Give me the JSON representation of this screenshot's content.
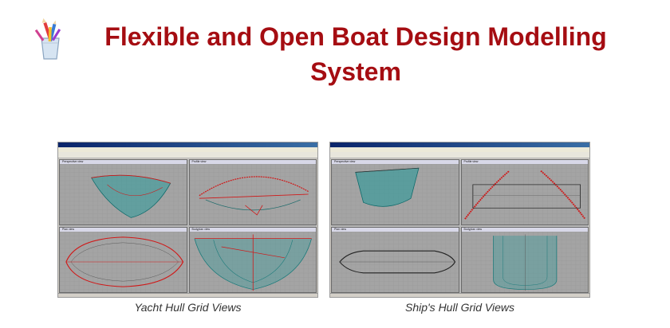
{
  "header": {
    "title_line1": "Flexible and Open Boat Design Modelling",
    "title_line2": "System",
    "title_color": "#a50d12",
    "logo_icon": "pencil-cup-icon"
  },
  "screenshots": [
    {
      "caption": "Yacht Hull Grid Views",
      "panes": [
        "Perspective view",
        "Profile view",
        "Plan view",
        "Bodyplan view"
      ]
    },
    {
      "caption": "Ship's Hull Grid Views",
      "panes": [
        "Perspective view",
        "Profile view",
        "Plan view",
        "Bodyplan view"
      ]
    }
  ],
  "colors": {
    "grid_bg": "#a4a4a4",
    "hull_lines": "#1a8a8a",
    "highlight": "#d01818"
  }
}
